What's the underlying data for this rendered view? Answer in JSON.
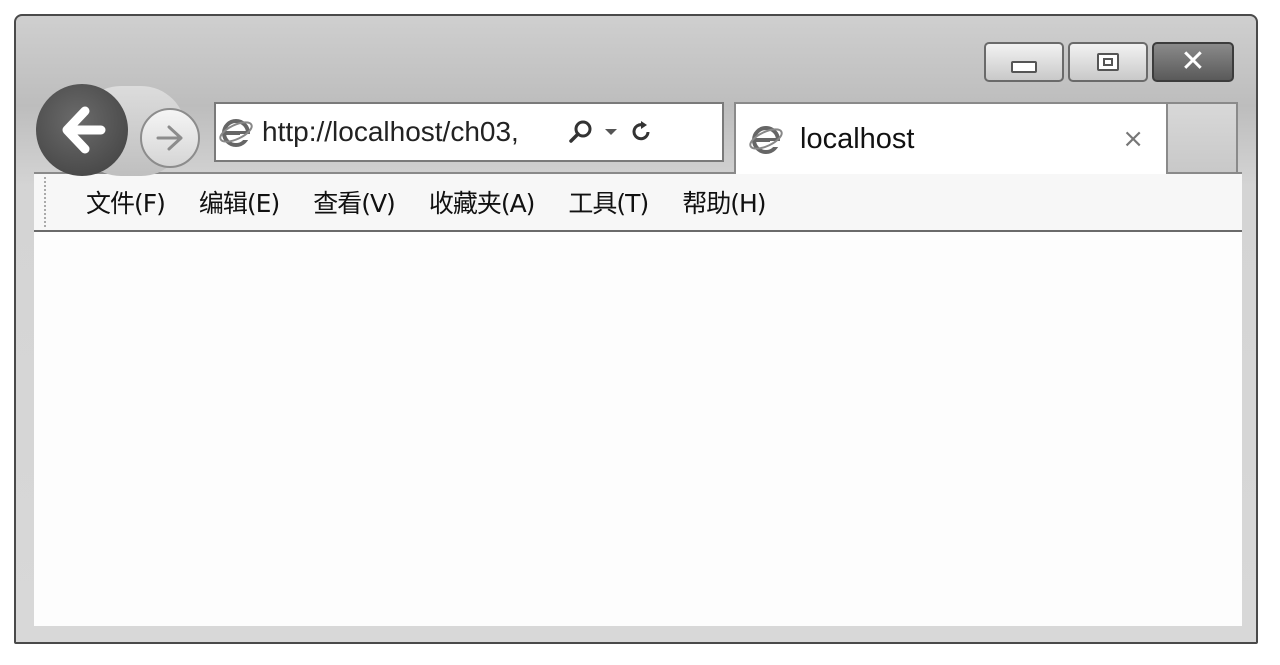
{
  "address_bar": {
    "url": "http://localhost/ch03,"
  },
  "tab": {
    "title": "localhost",
    "close_glyph": "×"
  },
  "menu": {
    "items": [
      "文件(F)",
      "编辑(E)",
      "查看(V)",
      "收藏夹(A)",
      "工具(T)",
      "帮助(H)"
    ]
  },
  "icons": {
    "back": "back-arrow-icon",
    "forward": "forward-arrow-icon",
    "page": "ie-logo-icon",
    "search": "search-icon",
    "dropdown": "chevron-down-icon",
    "refresh": "refresh-icon",
    "minimize": "minimize-icon",
    "maximize": "maximize-icon",
    "close": "close-icon"
  }
}
